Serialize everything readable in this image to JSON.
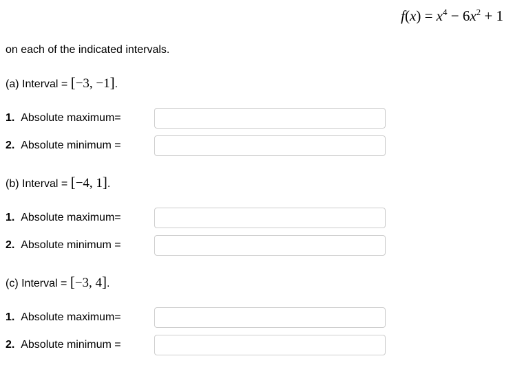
{
  "formula": {
    "raw": "f(x) = x^4 − 6x^2 + 1"
  },
  "instruction": "on each of the indicated intervals.",
  "sections": [
    {
      "label": "(a) Interval = ",
      "interval": "[−3, −1]",
      "questions": [
        {
          "num": "1.",
          "text": "Absolute maximum=",
          "value": ""
        },
        {
          "num": "2.",
          "text": "Absolute minimum =",
          "value": ""
        }
      ]
    },
    {
      "label": "(b) Interval = ",
      "interval": "[−4, 1]",
      "questions": [
        {
          "num": "1.",
          "text": "Absolute maximum=",
          "value": ""
        },
        {
          "num": "2.",
          "text": "Absolute minimum =",
          "value": ""
        }
      ]
    },
    {
      "label": "(c) Interval = ",
      "interval": "[−3, 4]",
      "questions": [
        {
          "num": "1.",
          "text": "Absolute maximum=",
          "value": ""
        },
        {
          "num": "2.",
          "text": "Absolute minimum =",
          "value": ""
        }
      ]
    }
  ]
}
